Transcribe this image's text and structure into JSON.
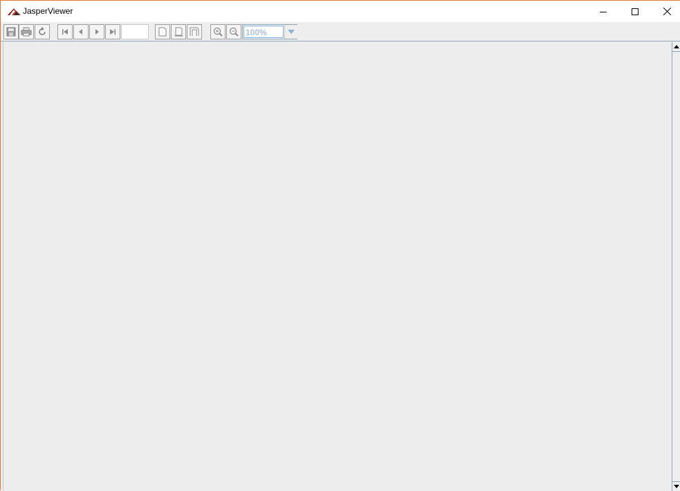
{
  "window": {
    "title": "JasperViewer",
    "accent_border": "#e57439"
  },
  "toolbar": {
    "save_icon": "save-icon",
    "print_icon": "print-icon",
    "reload_icon": "reload-icon",
    "first_icon": "first-page-icon",
    "prev_icon": "previous-page-icon",
    "next_icon": "next-page-icon",
    "last_icon": "last-page-icon",
    "page_number_value": "",
    "actual_size_icon": "actual-size-icon",
    "fit_page_icon": "fit-page-icon",
    "fit_width_icon": "fit-width-icon",
    "zoom_in_icon": "zoom-in-icon",
    "zoom_out_icon": "zoom-out-icon",
    "zoom_value": "100%"
  },
  "colors": {
    "content_bg": "#ededed",
    "toolbar_bg": "#eeeeee",
    "zoom_text": "#a8c2dc"
  }
}
